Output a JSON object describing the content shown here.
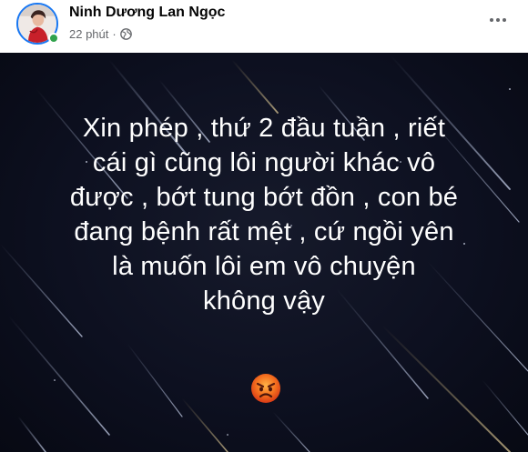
{
  "post": {
    "author": "Ninh Dương Lan Ngọc",
    "time": "22 phút",
    "separator": "·",
    "privacy_icon": "globe-icon",
    "more_icon": "more-options-icon",
    "online_color": "#31a24c",
    "text_lines": [
      "Xin phép , thứ 2 đầu tuần , riết",
      "cái gì cũng lôi người khác vô",
      "được , bớt tung bớt đồn , con bé",
      "đang bệnh rất mệt , cứ ngồi yên",
      "là muốn lôi em vô chuyện",
      "không vậy"
    ],
    "emoji": "angry-face-emoji",
    "background": "dark-starry-night-with-streaks"
  }
}
